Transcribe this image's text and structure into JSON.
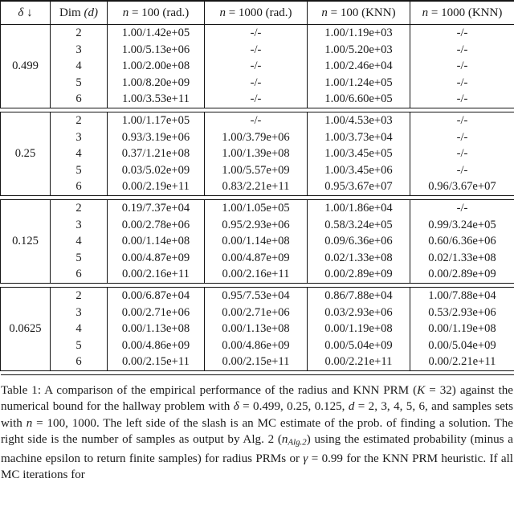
{
  "table": {
    "headers": [
      "δ ↓",
      "Dim (d)",
      "n = 100 (rad.)",
      "n = 1000 (rad.)",
      "n = 100 (KNN)",
      "n = 1000 (KNN)"
    ],
    "header_parts": {
      "delta_symbol": "δ",
      "delta_arrow": "↓",
      "dim_label": "Dim",
      "dim_var": "(d)",
      "n_var": "n",
      "col3_n": "100",
      "col3_kind": "(rad.)",
      "col4_n": "1000",
      "col4_kind": "(rad.)",
      "col5_n": "100",
      "col5_kind": "(KNN)",
      "col6_n": "1000",
      "col6_kind": "(KNN)"
    },
    "na": "-/-",
    "blocks": [
      {
        "delta": "0.499",
        "rows": [
          {
            "dim": "2",
            "n100_rad": "1.00/1.42e+05",
            "n1000_rad": "-/-",
            "n100_knn": "1.00/1.19e+03",
            "n1000_knn": "-/-"
          },
          {
            "dim": "3",
            "n100_rad": "1.00/5.13e+06",
            "n1000_rad": "-/-",
            "n100_knn": "1.00/5.20e+03",
            "n1000_knn": "-/-"
          },
          {
            "dim": "4",
            "n100_rad": "1.00/2.00e+08",
            "n1000_rad": "-/-",
            "n100_knn": "1.00/2.46e+04",
            "n1000_knn": "-/-"
          },
          {
            "dim": "5",
            "n100_rad": "1.00/8.20e+09",
            "n1000_rad": "-/-",
            "n100_knn": "1.00/1.24e+05",
            "n1000_knn": "-/-"
          },
          {
            "dim": "6",
            "n100_rad": "1.00/3.53e+11",
            "n1000_rad": "-/-",
            "n100_knn": "1.00/6.60e+05",
            "n1000_knn": "-/-"
          }
        ]
      },
      {
        "delta": "0.25",
        "rows": [
          {
            "dim": "2",
            "n100_rad": "1.00/1.17e+05",
            "n1000_rad": "-/-",
            "n100_knn": "1.00/4.53e+03",
            "n1000_knn": "-/-"
          },
          {
            "dim": "3",
            "n100_rad": "0.93/3.19e+06",
            "n1000_rad": "1.00/3.79e+06",
            "n100_knn": "1.00/3.73e+04",
            "n1000_knn": "-/-"
          },
          {
            "dim": "4",
            "n100_rad": "0.37/1.21e+08",
            "n1000_rad": "1.00/1.39e+08",
            "n100_knn": "1.00/3.45e+05",
            "n1000_knn": "-/-"
          },
          {
            "dim": "5",
            "n100_rad": "0.03/5.02e+09",
            "n1000_rad": "1.00/5.57e+09",
            "n100_knn": "1.00/3.45e+06",
            "n1000_knn": "-/-"
          },
          {
            "dim": "6",
            "n100_rad": "0.00/2.19e+11",
            "n1000_rad": "0.83/2.21e+11",
            "n100_knn": "0.95/3.67e+07",
            "n1000_knn": "0.96/3.67e+07"
          }
        ]
      },
      {
        "delta": "0.125",
        "rows": [
          {
            "dim": "2",
            "n100_rad": "0.19/7.37e+04",
            "n1000_rad": "1.00/1.05e+05",
            "n100_knn": "1.00/1.86e+04",
            "n1000_knn": "-/-"
          },
          {
            "dim": "3",
            "n100_rad": "0.00/2.78e+06",
            "n1000_rad": "0.95/2.93e+06",
            "n100_knn": "0.58/3.24e+05",
            "n1000_knn": "0.99/3.24e+05"
          },
          {
            "dim": "4",
            "n100_rad": "0.00/1.14e+08",
            "n1000_rad": "0.00/1.14e+08",
            "n100_knn": "0.09/6.36e+06",
            "n1000_knn": "0.60/6.36e+06"
          },
          {
            "dim": "5",
            "n100_rad": "0.00/4.87e+09",
            "n1000_rad": "0.00/4.87e+09",
            "n100_knn": "0.02/1.33e+08",
            "n1000_knn": "0.02/1.33e+08"
          },
          {
            "dim": "6",
            "n100_rad": "0.00/2.16e+11",
            "n1000_rad": "0.00/2.16e+11",
            "n100_knn": "0.00/2.89e+09",
            "n1000_knn": "0.00/2.89e+09"
          }
        ]
      },
      {
        "delta": "0.0625",
        "rows": [
          {
            "dim": "2",
            "n100_rad": "0.00/6.87e+04",
            "n1000_rad": "0.95/7.53e+04",
            "n100_knn": "0.86/7.88e+04",
            "n1000_knn": "1.00/7.88e+04"
          },
          {
            "dim": "3",
            "n100_rad": "0.00/2.71e+06",
            "n1000_rad": "0.00/2.71e+06",
            "n100_knn": "0.03/2.93e+06",
            "n1000_knn": "0.53/2.93e+06"
          },
          {
            "dim": "4",
            "n100_rad": "0.00/1.13e+08",
            "n1000_rad": "0.00/1.13e+08",
            "n100_knn": "0.00/1.19e+08",
            "n1000_knn": "0.00/1.19e+08"
          },
          {
            "dim": "5",
            "n100_rad": "0.00/4.86e+09",
            "n1000_rad": "0.00/4.86e+09",
            "n100_knn": "0.00/5.04e+09",
            "n1000_knn": "0.00/5.04e+09"
          },
          {
            "dim": "6",
            "n100_rad": "0.00/2.15e+11",
            "n1000_rad": "0.00/2.15e+11",
            "n100_knn": "0.00/2.21e+11",
            "n1000_knn": "0.00/2.21e+11"
          }
        ]
      }
    ]
  },
  "caption": {
    "label": "Table 1:",
    "text_part1": " A comparison of the empirical performance of the radius and KNN PRM (",
    "k_var": "K",
    "k_eq": " = 32) against the numerical bound for the hallway problem with ",
    "delta_var": "δ",
    "delta_eq": " = 0.499, 0.25, 0.125, ",
    "d_var": "d",
    "d_eq": " = 2, 3, 4, 5, 6, and samples sets with ",
    "n_var": "n",
    "n_eq": " = 100, 1000. The left side of the slash is an MC estimate of the prob. of finding a solution. The right side is the number of samples as output by Alg. 2 (",
    "n_alg_var": "n",
    "n_alg_sub": "Alg.2",
    "text_part2": ") using the estimated probability (minus a machine epsilon to return finite samples) for radius PRMs or ",
    "gamma_var": "γ",
    "gamma_eq": " = 0.99 for the KNN PRM heuristic. If all MC iterations for"
  }
}
